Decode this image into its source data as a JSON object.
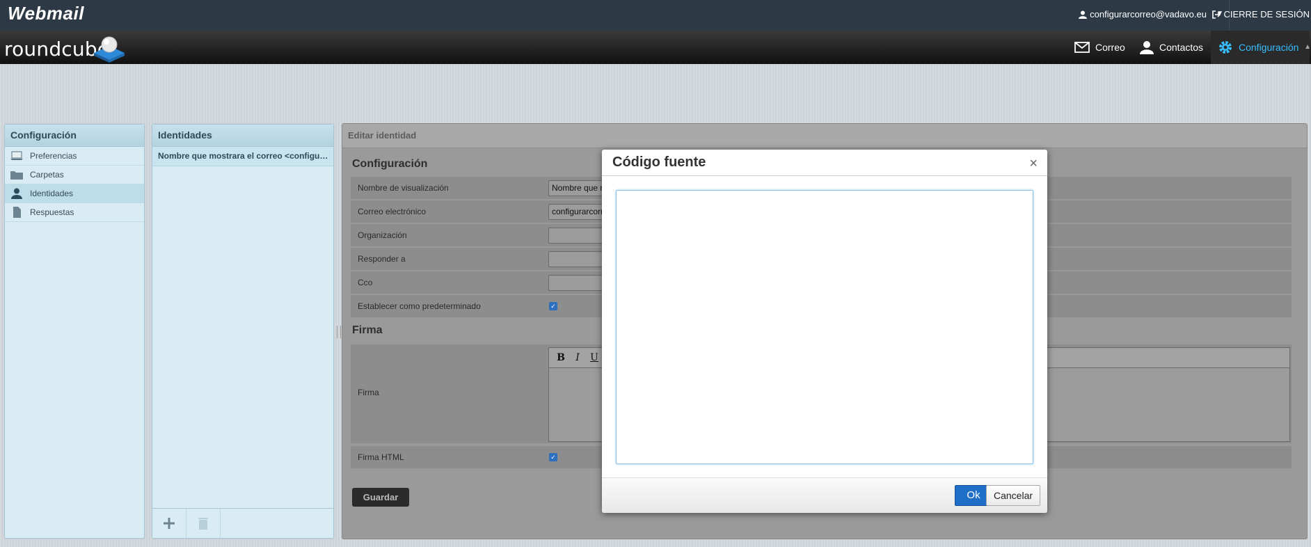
{
  "header": {
    "brand": "Webmail",
    "user_email": "configurarcorreo@vadavo.eu",
    "logout_label": "CIERRE DE SESIÓN",
    "logo_text": "roundcube"
  },
  "nav": {
    "items": [
      {
        "label": "Correo",
        "icon": "envelope-icon"
      },
      {
        "label": "Contactos",
        "icon": "person-icon"
      },
      {
        "label": "Configuración",
        "icon": "gear-icon",
        "active": true
      }
    ],
    "accent": "#37beff"
  },
  "settings_panel": {
    "title": "Configuración",
    "items": [
      {
        "label": "Preferencias",
        "icon": "laptop-icon"
      },
      {
        "label": "Carpetas",
        "icon": "folder-icon"
      },
      {
        "label": "Identidades",
        "icon": "person-icon",
        "selected": true
      },
      {
        "label": "Respuestas",
        "icon": "document-icon"
      }
    ]
  },
  "identities_panel": {
    "title": "Identidades",
    "items": [
      {
        "label": "Nombre que mostrara el correo <configurarcorreo@vadavo.eu>"
      }
    ]
  },
  "edit_panel": {
    "title": "Editar identidad",
    "section_config": "Configuración",
    "fields": [
      {
        "label": "Nombre de visualización",
        "value": "Nombre que mostrara el correo"
      },
      {
        "label": "Correo electrónico",
        "value": "configurarcorreo@vadavo.eu"
      },
      {
        "label": "Organización",
        "value": ""
      },
      {
        "label": "Responder a",
        "value": ""
      },
      {
        "label": "Cco",
        "value": ""
      }
    ],
    "default_label": "Establecer como predeterminado",
    "section_signature": "Firma",
    "signature_label": "Firma",
    "html_signature_label": "Firma HTML",
    "toolbar": {
      "bold": "B",
      "italic": "I",
      "underline": "U"
    },
    "save_label": "Guardar"
  },
  "dialog": {
    "title": "Código fuente",
    "close": "×",
    "source_value": "",
    "ok_label": "Ok",
    "cancel_label": "Cancelar"
  }
}
